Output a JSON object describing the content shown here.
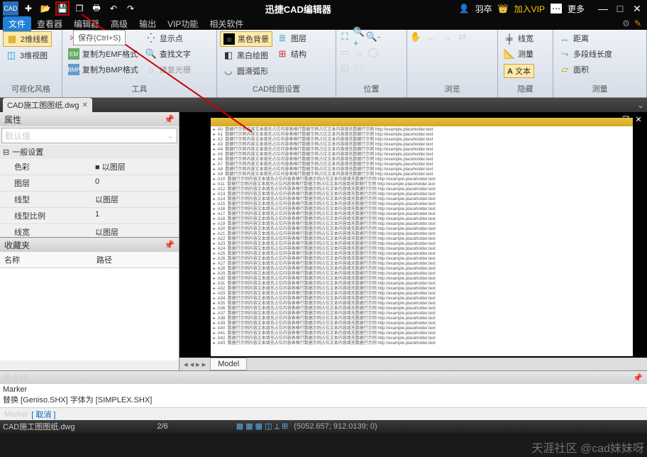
{
  "title": "迅捷CAD编辑器",
  "user": {
    "name": "羽卒",
    "vip_btn": "加入VIP",
    "more": "更多"
  },
  "tooltip": "保存(Ctrl+S)",
  "menu": [
    "文件",
    "查看器",
    "编辑器",
    "高级",
    "输出",
    "VIP功能",
    "相关软件"
  ],
  "ribbon": {
    "g1": {
      "b1": "2维线框",
      "b2": "3维视图",
      "label": "可视化风格"
    },
    "g2": {
      "b1": "剪切框架",
      "b2": "复制为EMF格式",
      "b3": "复制为BMP格式",
      "b4": "显示点",
      "b5": "查找文字",
      "b6": "修复光栅",
      "label": "工具"
    },
    "g3": {
      "b1": "黑色背景",
      "b2": "黑白绘图",
      "b3": "圆滑弧形",
      "b4": "图层",
      "b5": "结构",
      "label": "CAD绘图设置"
    },
    "g4": {
      "label": "位置"
    },
    "g5": {
      "label": "浏览"
    },
    "g6": {
      "b1": "线宽",
      "b2": "测量",
      "b3": "文本",
      "label": "隐藏"
    },
    "g7": {
      "b1": "距离",
      "b2": "多段线长度",
      "b3": "面积",
      "label": "测量"
    }
  },
  "doc_tab": "CAD施工图图纸.dwg",
  "props": {
    "title": "属性",
    "default": "默认值",
    "section": "一般设置",
    "rows": [
      {
        "name": "色彩",
        "val": "■ 以图层"
      },
      {
        "name": "图层",
        "val": "0"
      },
      {
        "name": "线型",
        "val": "以图层"
      },
      {
        "name": "线型比例",
        "val": "1"
      },
      {
        "name": "线宽",
        "val": "以图层"
      }
    ]
  },
  "fav": {
    "title": "收藏夹",
    "col1": "名称",
    "col2": "路径"
  },
  "model_tab": "Model",
  "cmd": {
    "title": "命令行",
    "line1": "Marker",
    "line2": "替换 [Geniso.SHX] 字体为 [SIMPLEX.SHX]",
    "input": "Marker",
    "cancel": "[ 取消 ]"
  },
  "status": {
    "file": "CAD施工图图纸.dwg",
    "pages": "2/6",
    "coords": "(5052.657; 912.0139; 0)"
  },
  "watermark": "天涯社区 @cad妹妹呀"
}
